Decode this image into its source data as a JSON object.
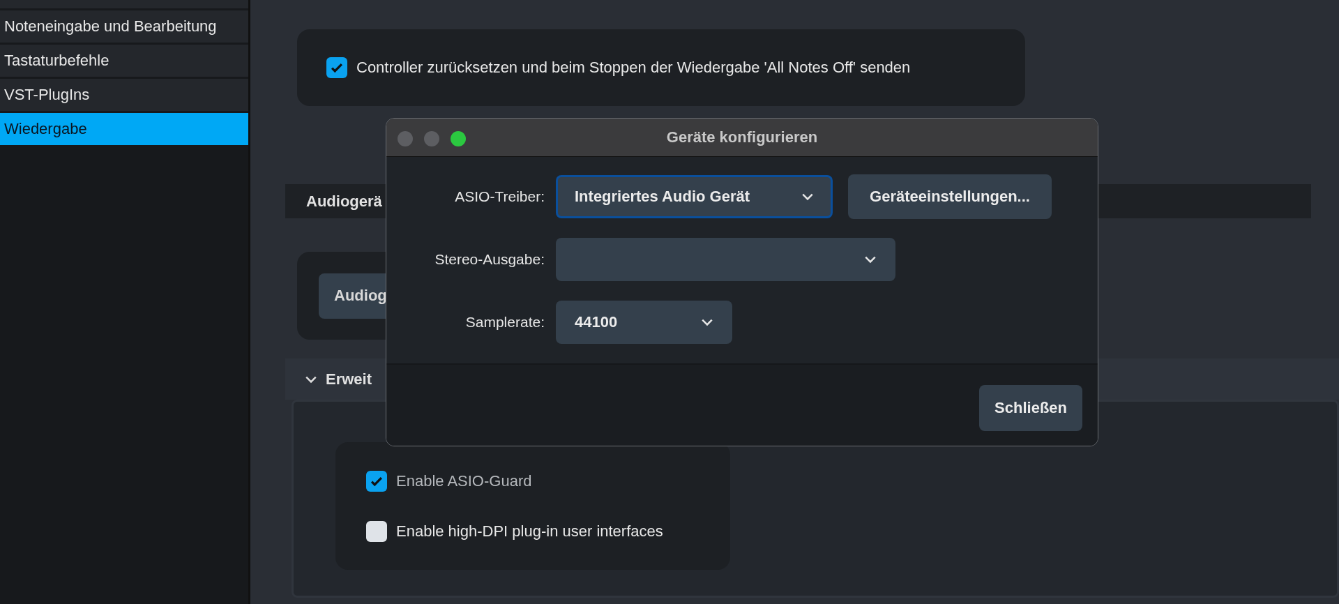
{
  "sidebar": {
    "items": [
      {
        "label": "Noteneingabe und Bearbeitung",
        "selected": false
      },
      {
        "label": "Tastaturbefehle",
        "selected": false
      },
      {
        "label": "VST-PlugIns",
        "selected": false
      },
      {
        "label": "Wiedergabe",
        "selected": true
      }
    ]
  },
  "controller_option": {
    "label": "Controller zurücksetzen und beim Stoppen der Wiedergabe 'All Notes Off' senden",
    "checked": true
  },
  "audio_section": {
    "title": "Audiogerä",
    "button": "Audiog"
  },
  "advanced_section": {
    "title": "Erweit",
    "expanded": true,
    "options": [
      {
        "label": "Enable ASIO-Guard",
        "checked": true
      },
      {
        "label": "Enable high-DPI plug-in user interfaces",
        "checked": false
      }
    ]
  },
  "dialog": {
    "title": "Geräte konfigurieren",
    "fields": [
      {
        "label": "ASIO-Treiber:",
        "value": "Integriertes Audio Gerät",
        "focused": true,
        "kind": "wide"
      },
      {
        "label": "Stereo-Ausgabe:",
        "focused": false,
        "kind": "full"
      },
      {
        "label": "Samplerate:",
        "value": "44100",
        "focused": false,
        "kind": "narrow"
      }
    ],
    "settings_button": "Geräteeinstellungen...",
    "close_button": "Schließen"
  }
}
